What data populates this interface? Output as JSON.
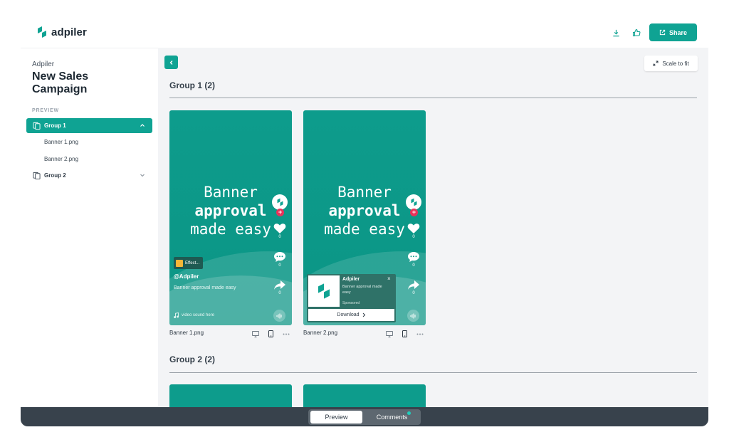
{
  "brand": {
    "name": "adpiler",
    "accent": "#0fa393"
  },
  "header": {
    "share_label": "Share",
    "icons": [
      "download-icon",
      "thumbs-up-icon",
      "share-icon"
    ]
  },
  "sidebar": {
    "owner": "Adpiler",
    "campaign_title": "New Sales Campaign",
    "section_label": "PREVIEW",
    "groups": [
      {
        "label": "Group 1",
        "expanded": true,
        "files": [
          "Banner 1.png",
          "Banner 2.png"
        ]
      },
      {
        "label": "Group 2",
        "expanded": false,
        "files": []
      }
    ]
  },
  "main": {
    "scale_label": "Scale to fit",
    "groups": [
      {
        "title": "Group 1 (2)",
        "cards": [
          {
            "name": "Banner 1.png",
            "headline_1": "Banner",
            "headline_2": "approval",
            "headline_3": "made easy",
            "counts": [
              "0",
              "0",
              "0"
            ],
            "effect": "Effect...",
            "handle": "@Adpiler",
            "caption": "Banner approval made easy",
            "sound": "video sound here"
          },
          {
            "name": "Banner 2.png",
            "headline_1": "Banner",
            "headline_2": "approval",
            "headline_3": "made easy",
            "counts": [
              "0",
              "0",
              "0"
            ],
            "ad_name": "Adpiler",
            "ad_close": "×",
            "ad_desc": "Banner approval made easy",
            "ad_sponsored": "Sponsored",
            "ad_cta": "Download"
          }
        ]
      },
      {
        "title": "Group 2 (2)"
      }
    ]
  },
  "bottom": {
    "tabs": [
      "Preview",
      "Comments"
    ],
    "active": "Preview"
  }
}
